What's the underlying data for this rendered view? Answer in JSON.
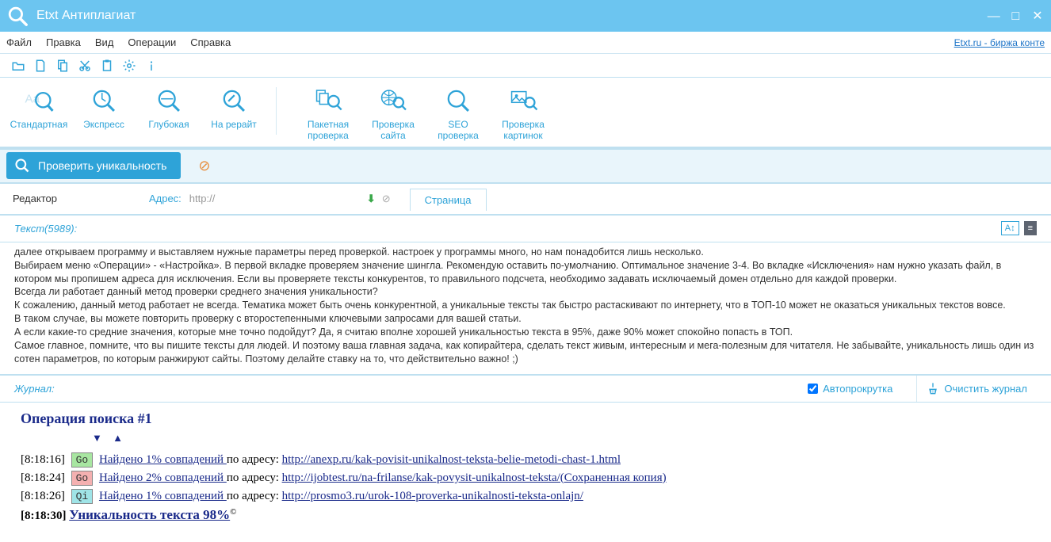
{
  "titlebar": {
    "title": "Etxt Антиплагиат"
  },
  "menu": {
    "file": "Файл",
    "edit": "Правка",
    "view": "Вид",
    "ops": "Операции",
    "help": "Справка",
    "rightlink": "Etxt.ru - биржа конте"
  },
  "toolbar": {
    "standard": "Стандартная",
    "express": "Экспресс",
    "deep": "Глубокая",
    "rewrite": "На рерайт",
    "batch": "Пакетная\nпроверка",
    "site": "Проверка\nсайта",
    "seo": "SEO\nпроверка",
    "images": "Проверка\nкартинок"
  },
  "action": {
    "check": "Проверить уникальность"
  },
  "editor": {
    "tab": "Редактор",
    "addr_label": "Адрес:",
    "addr_value": "http://",
    "page_tab": "Страница",
    "text_label": "Текст(5989):"
  },
  "content": {
    "p1": "далее открываем программу и выставляем нужные параметры перед проверкой. настроек у программы много, но нам понадобится лишь несколько.",
    "p2": "Выбираем меню «Операции» - «Настройка». В первой вкладке проверяем значение шингла. Рекомендую оставить по-умолчанию. Оптимальное значение 3-4. Во вкладке «Исключения» нам нужно указать файл, в котором мы пропишем адреса для исключения. Если вы проверяете тексты конкурентов, то правильного подсчета, необходимо задавать исключаемый домен отдельно для каждой проверки.",
    "p3": "Всегда ли работает данный метод проверки среднего значения уникальности?",
    "p4": "К сожалению, данный метод работает не всегда. Тематика может быть очень конкурентной, а уникальные тексты так быстро растаскивают по интернету, что в ТОП-10 может не оказаться уникальных текстов вовсе.",
    "p5": "В таком случае, вы можете повторить проверку с второстепенными ключевыми запросами для вашей статьи.",
    "p6": "А если какие-то средние значения, которые мне точно подойдут? Да, я считаю вполне хорошей уникальностью текста в 95%, даже 90% может спокойно попасть в ТОП.",
    "p7": "Самое главное, помните, что вы пишите тексты для людей. И поэтому ваша главная задача, как копирайтера, сделать текст живым, интересным и мега-полезным для читателя.  Не забывайте, уникальность лишь один из сотен параметров, по которым ранжируют сайты. Поэтому делайте ставку на то, что действительно важно! ;)"
  },
  "journal": {
    "label": "Журнал:",
    "autoscroll": "Автопрокрутка",
    "clear": "Очистить журнал",
    "op_title": "Операция поиска #1",
    "lines": [
      {
        "ts": "[8:18:16]",
        "badge": "Go",
        "badge_cls": "b-green",
        "match": "Найдено 1% совпадений",
        "addr_label": " по адресу: ",
        "url": "http://anexp.ru/kak-povisit-unikalnost-teksta-belie-metodi-chast-1.html"
      },
      {
        "ts": "[8:18:24]",
        "badge": "Go",
        "badge_cls": "b-red",
        "match": "Найдено 2% совпадений",
        "addr_label": " по адресу: ",
        "url": "http://ijobtest.ru/na-frilanse/kak-povysit-unikalnost-teksta/(Сохраненная копия)"
      },
      {
        "ts": "[8:18:26]",
        "badge": "Qi",
        "badge_cls": "b-cyan",
        "match": "Найдено 1% совпадений",
        "addr_label": " по адресу: ",
        "url": "http://prosmo3.ru/urok-108-proverka-unikalnosti-teksta-onlajn/"
      }
    ],
    "final_ts": "[8:18:30]",
    "final_text": "Уникальность текста 98%"
  }
}
